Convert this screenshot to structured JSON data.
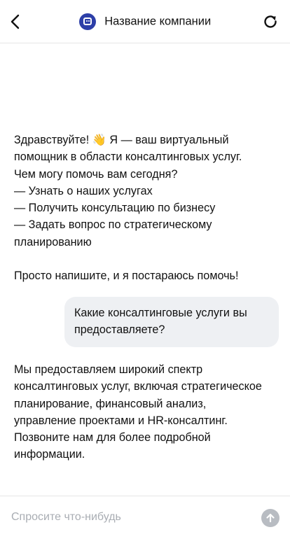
{
  "header": {
    "company_name": "Название компании",
    "back_icon": "chevron-left-icon",
    "refresh_icon": "refresh-icon",
    "logo_icon": "chat-bot-icon",
    "logo_color": "#2d3fa8"
  },
  "messages": {
    "greeting": {
      "line1": "Здравствуйте! 👋 Я — ваш виртуальный помощник в области консалтинговых услуг. Чем могу помочь вам сегодня?",
      "option1": "— Узнать о наших услугах",
      "option2": "— Получить консультацию по бизнесу",
      "option3": "— Задать вопрос по стратегическому планированию",
      "closing": "Просто напишите, и я постараюсь помочь!"
    },
    "user_question": "Какие консалтинговые услуги вы предоставляете?",
    "bot_answer": "Мы предоставляем широкий спектр консалтинговых услуг, включая стратегическое планирование, финансовый анализ, управление проектами и HR-консалтинг. Позвоните нам для более подробной информации."
  },
  "composer": {
    "placeholder": "Спросите что-нибудь",
    "value": "",
    "send_icon": "arrow-up-icon",
    "send_color": "#b8bcc2"
  }
}
